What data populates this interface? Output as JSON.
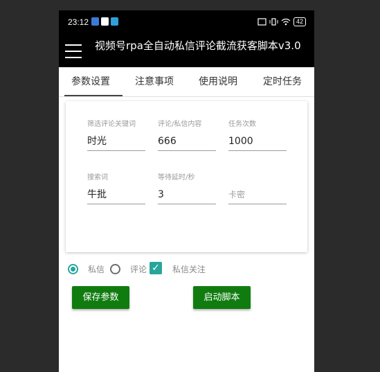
{
  "status_bar": {
    "time": "23:12",
    "battery": "42"
  },
  "app_bar": {
    "title": "视频号rpa全自动私信评论截流获客脚本v3.0"
  },
  "tabs": [
    {
      "label": "参数设置"
    },
    {
      "label": "注意事项"
    },
    {
      "label": "使用说明"
    },
    {
      "label": "定时任务"
    }
  ],
  "form": {
    "filter_keyword": {
      "label": "筛选评论关键词",
      "value": "时光"
    },
    "message_content": {
      "label": "评论/私信内容",
      "value": "666"
    },
    "task_count": {
      "label": "任务次数",
      "value": "1000"
    },
    "search_term": {
      "label": "搜索词",
      "value": "牛批"
    },
    "wait_delay": {
      "label": "等待延时/秒",
      "value": "3"
    },
    "card_key": {
      "placeholder": "卡密"
    }
  },
  "options": {
    "private_message": "私信",
    "comment": "评论",
    "follow_after_message": "私信关注"
  },
  "buttons": {
    "save": "保存参数",
    "start": "启动脚本"
  },
  "colors": {
    "accent": "#26a69a",
    "button": "#107c10",
    "app_bar": "#000000"
  }
}
